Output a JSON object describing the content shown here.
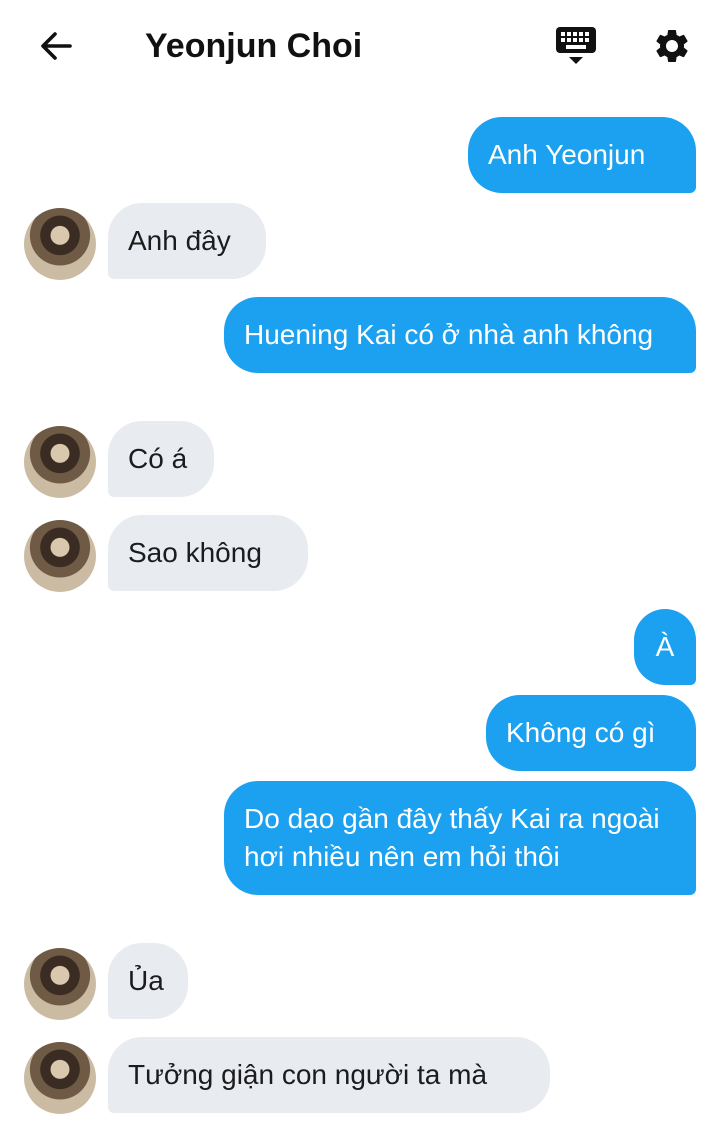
{
  "header": {
    "title": "Yeonjun Choi",
    "back_icon": "arrow-left-icon",
    "keyboard_icon": "keyboard-icon",
    "settings_icon": "gear-icon"
  },
  "colors": {
    "outgoing_bubble": "#1ca1f1",
    "incoming_bubble": "#e8ebef"
  },
  "messages": [
    {
      "from": "me",
      "text": "Anh Yeonjun"
    },
    {
      "from": "contact",
      "text": "Anh đây"
    },
    {
      "from": "me",
      "text": "Huening Kai có ở nhà anh không"
    },
    {
      "from": "contact",
      "text": "Có á"
    },
    {
      "from": "contact",
      "text": "Sao không"
    },
    {
      "from": "me",
      "text": "À"
    },
    {
      "from": "me",
      "text": "Không có gì"
    },
    {
      "from": "me",
      "text": "Do dạo gần đây thấy Kai ra ngoài hơi nhiều nên em hỏi thôi"
    },
    {
      "from": "contact",
      "text": "Ủa"
    },
    {
      "from": "contact",
      "text": "Tưởng giận con người ta mà"
    }
  ]
}
